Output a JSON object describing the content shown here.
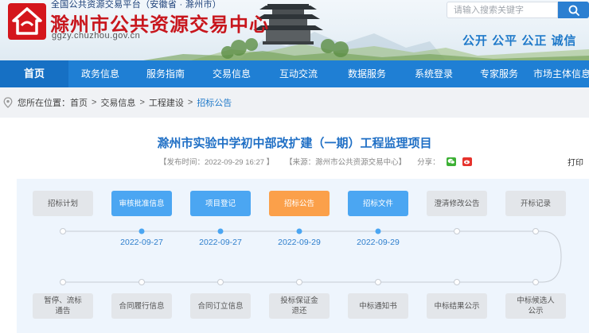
{
  "header": {
    "subtitle": "全国公共资源交易平台（安徽省 · 滁州市）",
    "site_title": "滁州市公共资源交易中心",
    "domain": "ggzy.chuzhou.gov.cn",
    "search_placeholder": "请输入搜索关键字",
    "slogan": "公开 公平 公正 诚信",
    "colors": {
      "brand_red": "#c8161d",
      "brand_blue": "#1f79c9"
    }
  },
  "nav": {
    "items": [
      {
        "label": "首页",
        "active": true
      },
      {
        "label": "政务信息"
      },
      {
        "label": "服务指南"
      },
      {
        "label": "交易信息"
      },
      {
        "label": "互动交流"
      },
      {
        "label": "数据服务"
      },
      {
        "label": "系统登录"
      },
      {
        "label": "专家服务"
      },
      {
        "label": "市场主体信息"
      }
    ]
  },
  "breadcrumb": {
    "prefix": "您所在位置：",
    "items": [
      "首页",
      "交易信息",
      "工程建设",
      "招标公告"
    ],
    "separator": ">"
  },
  "article": {
    "title": "滁州市实验中学初中部改扩建（一期）工程监理项目",
    "publish_time": "【发布时间：2022-09-29 16:27 】",
    "source": "【来源：滁州市公共资源交易中心】",
    "share_label": "分享：",
    "print_label": "打印"
  },
  "timeline": {
    "top_stages": [
      {
        "label": "招标计划",
        "status": "inactive",
        "date": ""
      },
      {
        "label": "审核批准信息",
        "status": "done",
        "date": "2022-09-27"
      },
      {
        "label": "项目登记",
        "status": "done",
        "date": "2022-09-27"
      },
      {
        "label": "招标公告",
        "status": "current",
        "date": "2022-09-29"
      },
      {
        "label": "招标文件",
        "status": "done",
        "date": "2022-09-29"
      },
      {
        "label": "澄清修改公告",
        "status": "inactive",
        "date": ""
      },
      {
        "label": "开标记录",
        "status": "inactive",
        "date": ""
      }
    ],
    "bottom_stages": [
      {
        "label": "暂停、流标\n通告",
        "status": "inactive"
      },
      {
        "label": "合同履行信息",
        "status": "inactive"
      },
      {
        "label": "合同订立信息",
        "status": "inactive"
      },
      {
        "label": "投标保证金\n退还",
        "status": "inactive"
      },
      {
        "label": "中标通知书",
        "status": "inactive"
      },
      {
        "label": "中标结果公示",
        "status": "inactive"
      },
      {
        "label": "中标候选人\n公示",
        "status": "inactive"
      }
    ],
    "colors": {
      "done": "#4ba6f2",
      "current": "#fba04a",
      "inactive": "#e3e6ea"
    }
  }
}
